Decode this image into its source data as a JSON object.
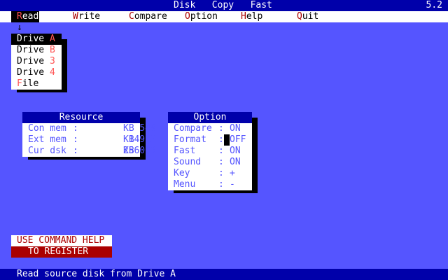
{
  "title": {
    "app": "Disk   Copy   Fast",
    "version": "5.2"
  },
  "menu": [
    {
      "hotkey": "R",
      "rest": "ead",
      "active": true
    },
    {
      "hotkey": "W",
      "rest": "rite"
    },
    {
      "hotkey": "C",
      "rest": "ompare"
    },
    {
      "hotkey": "O",
      "rest": "ption"
    },
    {
      "hotkey": "H",
      "rest": "elp"
    },
    {
      "hotkey": "Q",
      "rest": "uit"
    }
  ],
  "arrow": "↓",
  "dropdown": [
    {
      "prefix": "Drive ",
      "hotkey": "A",
      "suffix": "",
      "active": true
    },
    {
      "prefix": "Drive ",
      "hotkey": "B",
      "suffix": ""
    },
    {
      "prefix": "Drive ",
      "hotkey": "3",
      "suffix": ""
    },
    {
      "prefix": "Drive ",
      "hotkey": "4",
      "suffix": ""
    },
    {
      "prefix": "",
      "hotkey": "F",
      "suffix": "ile"
    }
  ],
  "resource": {
    "title": "Resource",
    "rows": [
      {
        "label": "Con mem",
        "value": "549",
        "unit": "KB"
      },
      {
        "label": "Ext mem",
        "value": "14912",
        "unit": "KB"
      },
      {
        "label": "Cur dsk",
        "value": "256000",
        "unit": "KB"
      }
    ]
  },
  "option": {
    "title": "Option",
    "rows": [
      {
        "label": "Compare",
        "value": "ON"
      },
      {
        "label": "Format",
        "value": "OFF"
      },
      {
        "label": "Fast",
        "value": "ON"
      },
      {
        "label": "Sound",
        "value": "ON"
      },
      {
        "label": "Key",
        "value": "+"
      },
      {
        "label": "Menu",
        "value": "-"
      }
    ]
  },
  "help": {
    "line1": "USE COMMAND HELP",
    "line2": "TO REGISTER"
  },
  "status": "Read source disk from Drive A"
}
